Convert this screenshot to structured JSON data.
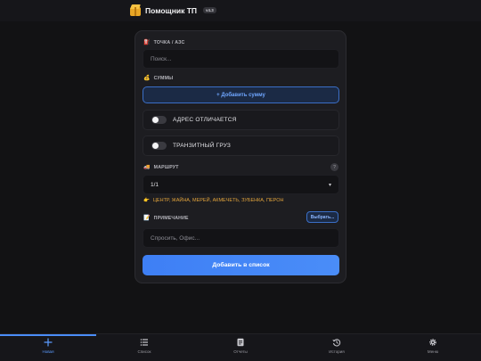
{
  "header": {
    "title": "Помощник ТП",
    "version": "v4.3"
  },
  "form": {
    "station": {
      "label": "ТОЧКА / АЗС",
      "placeholder": "Поиск..."
    },
    "sums": {
      "label": "СУММЫ",
      "add_button": "+ Добавить сумму"
    },
    "toggles": [
      {
        "label": "АДРЕС ОТЛИЧАЕТСЯ",
        "checked": false
      },
      {
        "label": "ТРАНЗИТНЫЙ ГРУЗ",
        "checked": false
      }
    ],
    "route": {
      "label": "МАРШРУТ",
      "help": "?",
      "selected": "1/1",
      "hint": "ЦЕНТР, ЖАЙНА, МЕРЕЙ, АКМЕЧЕТЬ, ЗУБЕНКА, ПЕРОН"
    },
    "note": {
      "label": "ПРИМЕЧАНИЕ",
      "choose_button": "Выбрать...",
      "placeholder": "Спросить, Офис..."
    },
    "submit_label": "Добавить в список"
  },
  "nav": {
    "items": [
      {
        "label": "Новая",
        "icon": "plus-icon",
        "active": true
      },
      {
        "label": "Список",
        "icon": "list-icon",
        "active": false
      },
      {
        "label": "Отчеты",
        "icon": "document-icon",
        "active": false
      },
      {
        "label": "История",
        "icon": "history-icon",
        "active": false
      },
      {
        "label": "Меню",
        "icon": "gear-icon",
        "active": false
      }
    ]
  },
  "colors": {
    "accent": "#4a8df8",
    "hint": "#e0a23b",
    "background": "#121214",
    "card": "#1d1d21"
  }
}
